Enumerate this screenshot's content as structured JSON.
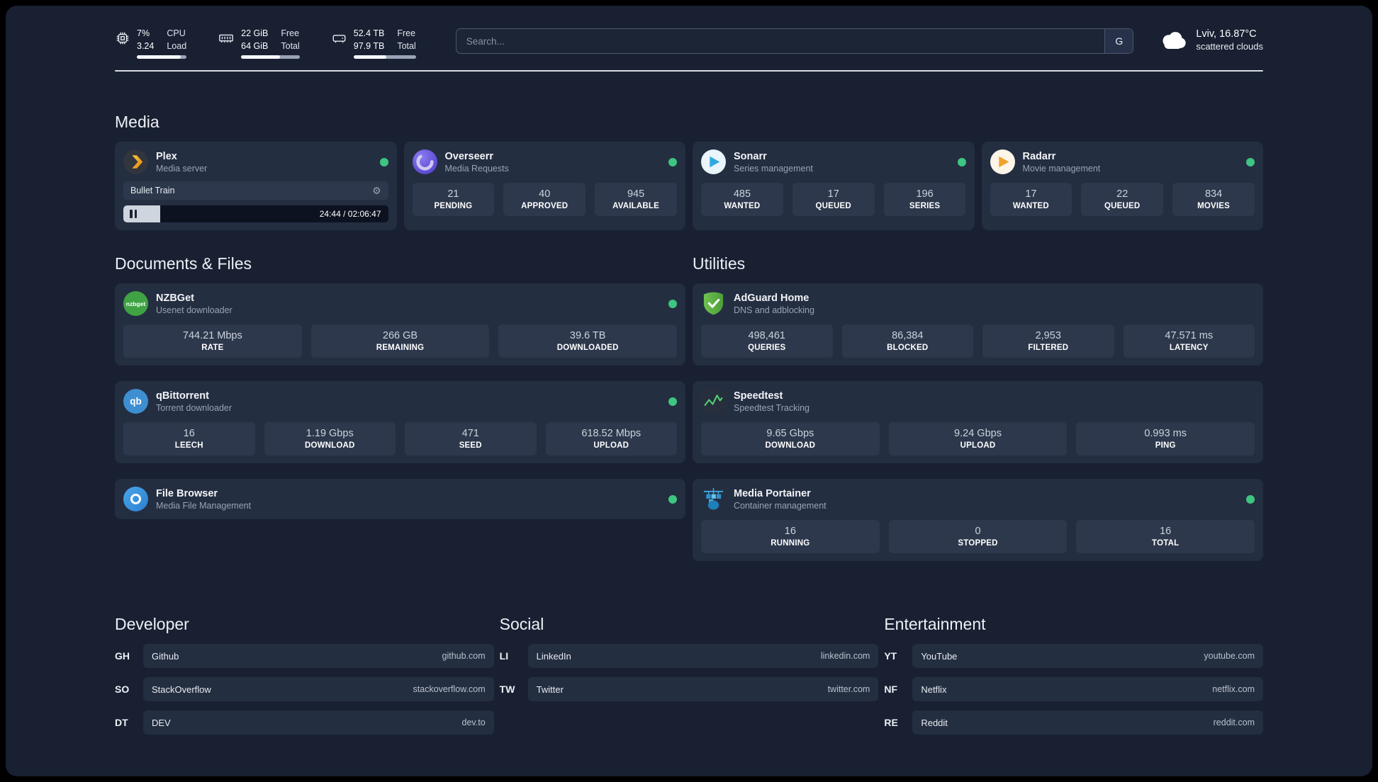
{
  "topbar": {
    "cpu": {
      "value1": "7%",
      "value2": "3.24",
      "label1": "CPU",
      "label2": "Load",
      "bar_percent": 88
    },
    "ram": {
      "value1": "22 GiB",
      "value2": "64 GiB",
      "label1": "Free",
      "label2": "Total",
      "bar_percent": 66
    },
    "disk": {
      "value1": "52.4 TB",
      "value2": "97.9 TB",
      "label1": "Free",
      "label2": "Total",
      "bar_percent": 52
    },
    "search": {
      "placeholder": "Search...",
      "engine": "G"
    },
    "weather": {
      "location": "Lviv, 16.87°C",
      "condition": "scattered clouds"
    }
  },
  "media": {
    "heading": "Media",
    "plex": {
      "name": "Plex",
      "subtitle": "Media server",
      "now_playing": "Bullet Train",
      "time": "24:44 / 02:06:47",
      "progress_percent": 14
    },
    "overseerr": {
      "name": "Overseerr",
      "subtitle": "Media Requests",
      "stats": [
        {
          "value": "21",
          "label": "PENDING"
        },
        {
          "value": "40",
          "label": "APPROVED"
        },
        {
          "value": "945",
          "label": "AVAILABLE"
        }
      ]
    },
    "sonarr": {
      "name": "Sonarr",
      "subtitle": "Series management",
      "stats": [
        {
          "value": "485",
          "label": "WANTED"
        },
        {
          "value": "17",
          "label": "QUEUED"
        },
        {
          "value": "196",
          "label": "SERIES"
        }
      ]
    },
    "radarr": {
      "name": "Radarr",
      "subtitle": "Movie management",
      "stats": [
        {
          "value": "17",
          "label": "WANTED"
        },
        {
          "value": "22",
          "label": "QUEUED"
        },
        {
          "value": "834",
          "label": "MOVIES"
        }
      ]
    }
  },
  "documents": {
    "heading": "Documents & Files",
    "nzbget": {
      "name": "NZBGet",
      "subtitle": "Usenet downloader",
      "icon_text": "nzbget",
      "stats": [
        {
          "value": "744.21 Mbps",
          "label": "RATE"
        },
        {
          "value": "266 GB",
          "label": "REMAINING"
        },
        {
          "value": "39.6 TB",
          "label": "DOWNLOADED"
        }
      ]
    },
    "qbittorrent": {
      "name": "qBittorrent",
      "subtitle": "Torrent downloader",
      "icon_text": "qb",
      "stats": [
        {
          "value": "16",
          "label": "LEECH"
        },
        {
          "value": "1.19 Gbps",
          "label": "DOWNLOAD"
        },
        {
          "value": "471",
          "label": "SEED"
        },
        {
          "value": "618.52 Mbps",
          "label": "UPLOAD"
        }
      ]
    },
    "filebrowser": {
      "name": "File Browser",
      "subtitle": "Media File Management"
    }
  },
  "utilities": {
    "heading": "Utilities",
    "adguard": {
      "name": "AdGuard Home",
      "subtitle": "DNS and adblocking",
      "stats": [
        {
          "value": "498,461",
          "label": "QUERIES"
        },
        {
          "value": "86,384",
          "label": "BLOCKED"
        },
        {
          "value": "2,953",
          "label": "FILTERED"
        },
        {
          "value": "47.571 ms",
          "label": "LATENCY"
        }
      ]
    },
    "speedtest": {
      "name": "Speedtest",
      "subtitle": "Speedtest Tracking",
      "stats": [
        {
          "value": "9.65 Gbps",
          "label": "DOWNLOAD"
        },
        {
          "value": "9.24 Gbps",
          "label": "UPLOAD"
        },
        {
          "value": "0.993 ms",
          "label": "PING"
        }
      ]
    },
    "portainer": {
      "name": "Media Portainer",
      "subtitle": "Container management",
      "stats": [
        {
          "value": "16",
          "label": "RUNNING"
        },
        {
          "value": "0",
          "label": "STOPPED"
        },
        {
          "value": "16",
          "label": "TOTAL"
        }
      ]
    }
  },
  "links": {
    "developer": {
      "heading": "Developer",
      "items": [
        {
          "abbr": "GH",
          "name": "Github",
          "url": "github.com"
        },
        {
          "abbr": "SO",
          "name": "StackOverflow",
          "url": "stackoverflow.com"
        },
        {
          "abbr": "DT",
          "name": "DEV",
          "url": "dev.to"
        }
      ]
    },
    "social": {
      "heading": "Social",
      "items": [
        {
          "abbr": "LI",
          "name": "LinkedIn",
          "url": "linkedin.com"
        },
        {
          "abbr": "TW",
          "name": "Twitter",
          "url": "twitter.com"
        }
      ]
    },
    "entertainment": {
      "heading": "Entertainment",
      "items": [
        {
          "abbr": "YT",
          "name": "YouTube",
          "url": "youtube.com"
        },
        {
          "abbr": "NF",
          "name": "Netflix",
          "url": "netflix.com"
        },
        {
          "abbr": "RE",
          "name": "Reddit",
          "url": "reddit.com"
        }
      ]
    }
  },
  "colors": {
    "status_green": "#3ec581",
    "plex_accent": "#e5a00d",
    "background": "#182032",
    "card": "#242e41"
  }
}
